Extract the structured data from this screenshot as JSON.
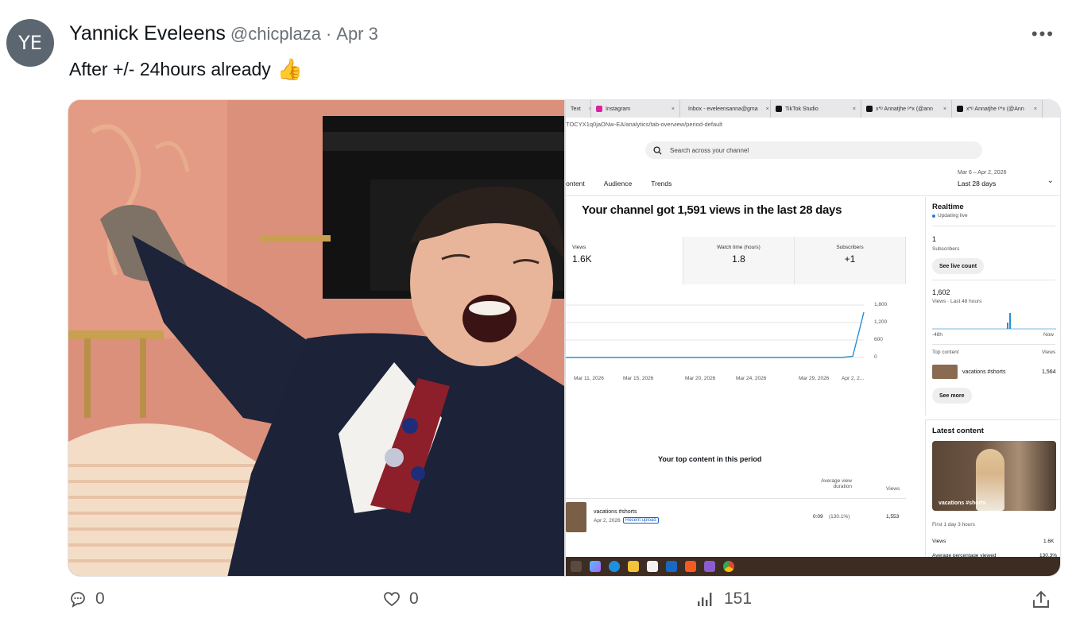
{
  "tweet": {
    "avatar_initials": "YE",
    "name": "Yannick Eveleens",
    "handle": "@chicplaza",
    "separator": "·",
    "date": "Apr 3",
    "text": "After +/- 24hours already",
    "emoji": "👍",
    "more_label": "•••"
  },
  "screenshot": {
    "tabs": [
      {
        "label": "Text",
        "color": "#999"
      },
      {
        "label": "Instagram",
        "color": "#d6249f"
      },
      {
        "label": "Inbox - eveleensanna@gma",
        "color": "#ea4335"
      },
      {
        "label": "TikTok Studio",
        "color": "#111"
      },
      {
        "label": "x*ᵖ Annatjhe ᵖ*x (@ann",
        "color": "#111"
      },
      {
        "label": "x*ᵖ Annatjhe ᵖ*x (@Ann",
        "color": "#111"
      }
    ],
    "url": "TOCYX1q0jaONw-EA/analytics/tab-overview/period-default",
    "search_placeholder": "Search across your channel",
    "nav": [
      "Content",
      "Audience",
      "Trends"
    ],
    "range_dates": "Mar 6 – Apr 2, 2026",
    "range_label": "Last 28 days",
    "headline": "Your channel got 1,591 views in the last 28 days",
    "metrics": [
      {
        "label": "Views",
        "value": "1.6K"
      },
      {
        "label": "Watch time (hours)",
        "value": "1.8"
      },
      {
        "label": "Subscribers",
        "value": "+1"
      }
    ],
    "realtime": {
      "title": "Realtime",
      "live": "Updating live",
      "subs_value": "1",
      "subs_label": "Subscribers",
      "live_count_btn": "See live count",
      "views_value": "1,602",
      "views_label": "Views · Last 48 hours",
      "axis_start": "-48h",
      "axis_end": "Now",
      "top_content_label": "Top content",
      "top_views_label": "Views",
      "top_title": "vacations #shorts",
      "top_views": "1,564",
      "see_more_btn": "See more"
    },
    "latest": {
      "title": "Latest content",
      "caption": "vacations #shorts",
      "first": "First 1 day 3 hours",
      "views_label": "Views",
      "views_value": "1.6K",
      "avg_label": "Average percentage viewed",
      "avg_value": "130.3%"
    },
    "top_content": {
      "title": "Your top content in this period",
      "col_avd": "Average view duration",
      "col_views": "Views",
      "row_title": "vacations #shorts",
      "row_date": "Apr 2, 2026",
      "row_badge": "Recent upload",
      "row_duration": "0:09",
      "row_pct": "(130.1%)",
      "row_views": "1,553"
    }
  },
  "chart_data": {
    "type": "line",
    "x": [
      "Mar 11, 2026",
      "Mar 15, 2026",
      "Mar 20, 2026",
      "Mar 24, 2026",
      "Mar 29, 2026",
      "Apr 2, 2..."
    ],
    "y_ticks": [
      "1,800",
      "1,200",
      "600",
      "0"
    ],
    "ylim": [
      0,
      1800
    ],
    "series": [
      {
        "values": [
          0,
          0,
          0,
          0,
          0,
          0,
          0,
          0,
          0,
          0,
          0,
          0,
          0,
          0,
          0,
          0,
          0,
          0,
          0,
          0,
          0,
          0,
          0,
          0,
          0,
          0,
          40,
          1551
        ]
      }
    ],
    "color": "#2b8fd0"
  },
  "actions": {
    "replies": "0",
    "likes": "0",
    "views": "151"
  }
}
